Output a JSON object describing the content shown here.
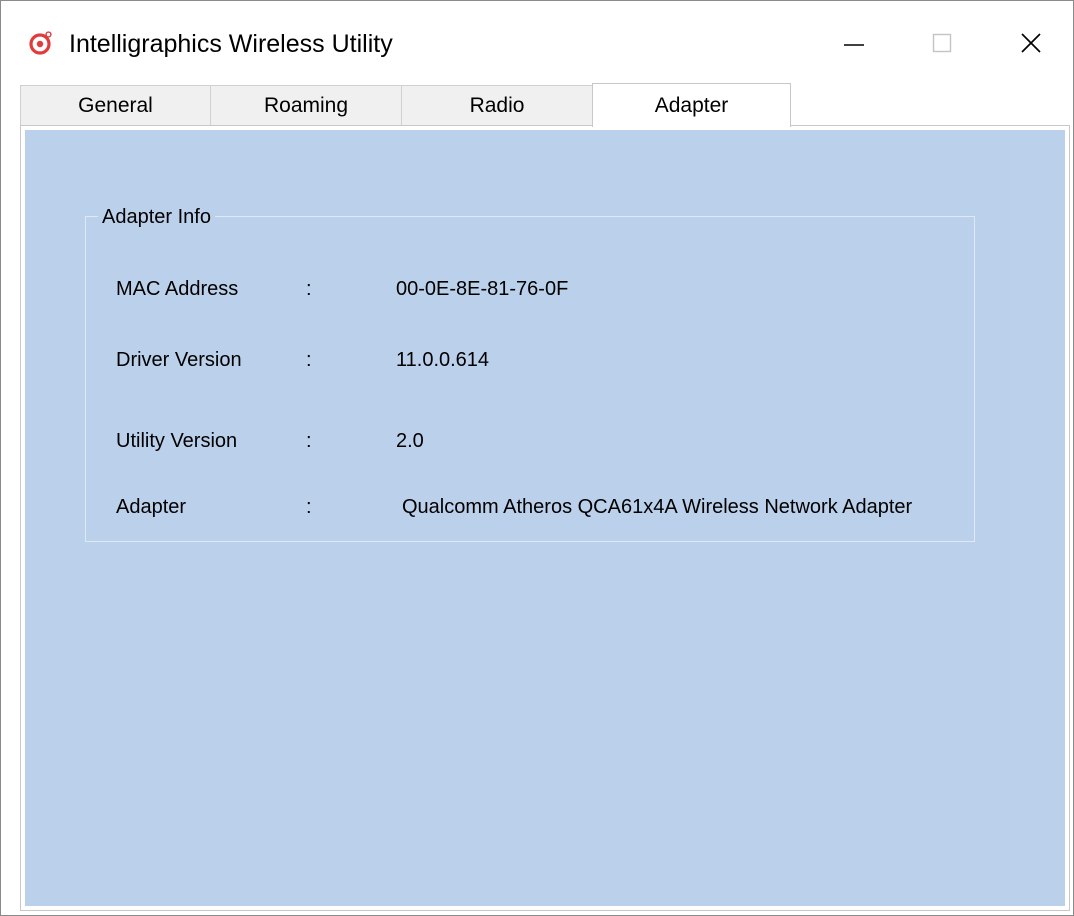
{
  "window": {
    "title": "Intelligraphics Wireless Utility",
    "icon": "app-target-icon",
    "accent_color": "#e23b3b"
  },
  "tabs": [
    {
      "label": "General",
      "active": false
    },
    {
      "label": "Roaming",
      "active": false
    },
    {
      "label": "Radio",
      "active": false
    },
    {
      "label": "Adapter",
      "active": true
    }
  ],
  "adapter_info": {
    "legend": "Adapter Info",
    "separator": ":",
    "rows": [
      {
        "label": "MAC Address",
        "value": "00-0E-8E-81-76-0F"
      },
      {
        "label": "Driver Version",
        "value": "11.0.0.614"
      },
      {
        "label": "Utility Version",
        "value": "2.0"
      },
      {
        "label": "Adapter",
        "value": "Qualcomm Atheros QCA61x4A Wireless Network Adapter"
      }
    ]
  },
  "colors": {
    "panel_background": "#bbd0ea"
  }
}
